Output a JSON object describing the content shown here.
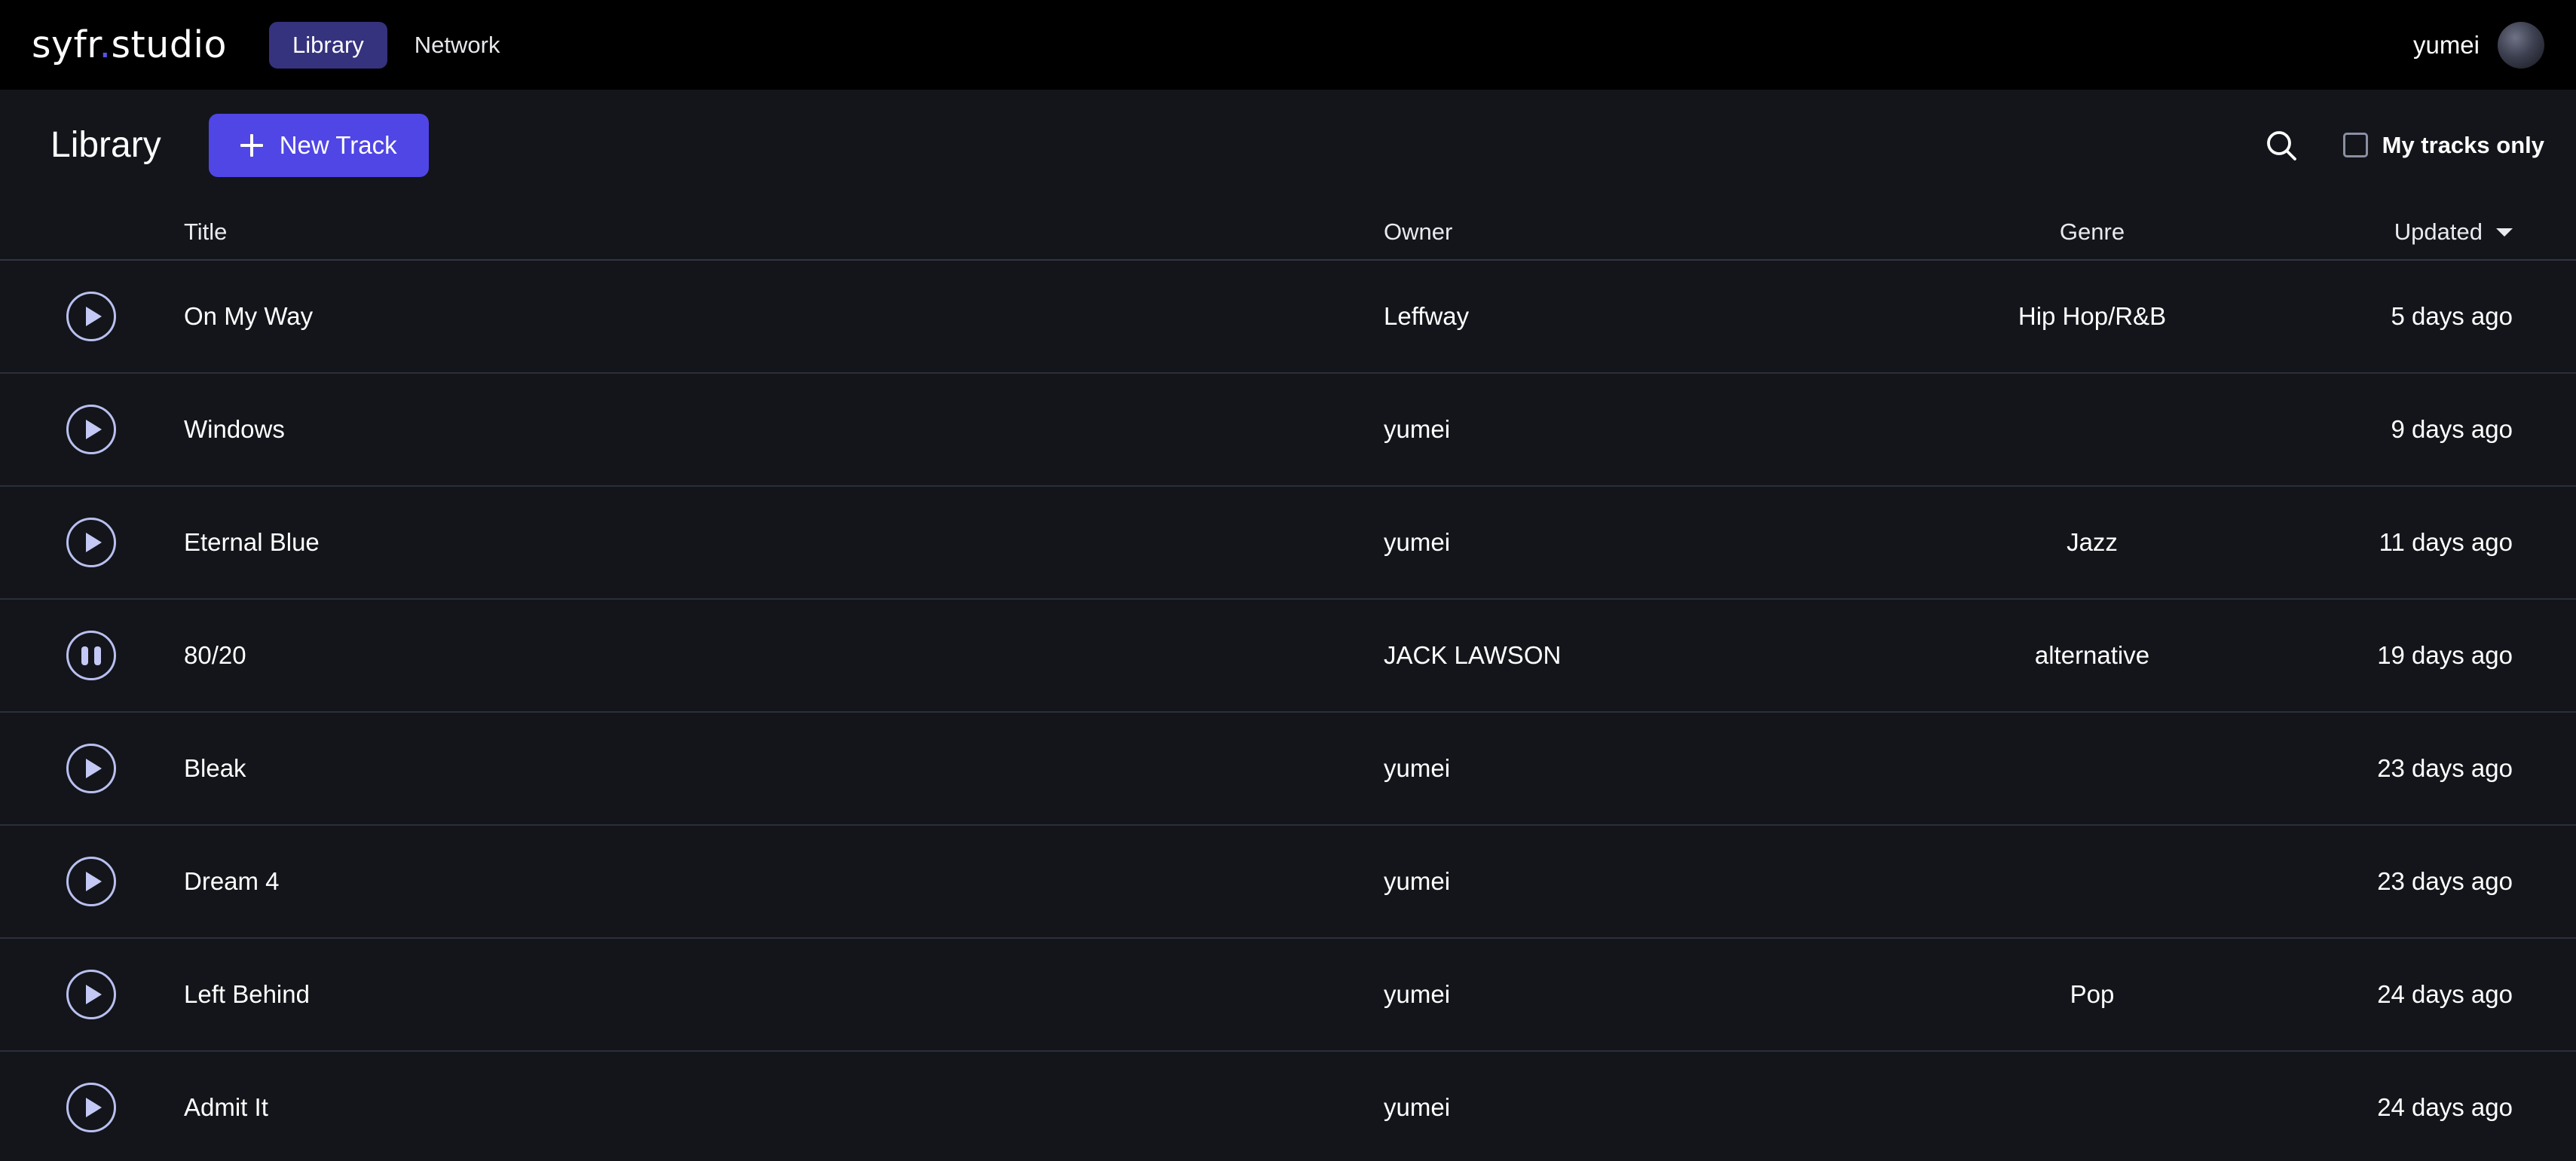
{
  "topbar": {
    "logo_prefix": "syfr",
    "logo_dot": ".",
    "logo_suffix": "studio",
    "nav": [
      {
        "label": "Library",
        "active": true
      },
      {
        "label": "Network",
        "active": false
      }
    ],
    "user_name": "yumei",
    "avatar_icon": "user-avatar"
  },
  "toolbar": {
    "page_title": "Library",
    "new_track_label": "New Track",
    "plus_icon": "plus-icon",
    "search_icon": "search-icon",
    "my_tracks_label": "My tracks only",
    "my_tracks_checked": false
  },
  "table": {
    "columns": {
      "title": "Title",
      "owner": "Owner",
      "genre": "Genre",
      "updated": "Updated"
    },
    "sort_caret_icon": "chevron-down-icon",
    "sorted_by": "Updated",
    "rows": [
      {
        "state_icon": "play-icon",
        "title": "On My Way",
        "owner": "Leffway",
        "genre": "Hip Hop/R&B",
        "updated": "5 days ago"
      },
      {
        "state_icon": "play-icon",
        "title": "Windows",
        "owner": "yumei",
        "genre": "",
        "updated": "9 days ago"
      },
      {
        "state_icon": "play-icon",
        "title": "Eternal Blue",
        "owner": "yumei",
        "genre": "Jazz",
        "updated": "11 days ago"
      },
      {
        "state_icon": "pause-icon",
        "title": "80/20",
        "owner": "JACK LAWSON",
        "genre": "alternative",
        "updated": "19 days ago"
      },
      {
        "state_icon": "play-icon",
        "title": "Bleak",
        "owner": "yumei",
        "genre": "",
        "updated": "23 days ago"
      },
      {
        "state_icon": "play-icon",
        "title": "Dream 4",
        "owner": "yumei",
        "genre": "",
        "updated": "23 days ago"
      },
      {
        "state_icon": "play-icon",
        "title": "Left Behind",
        "owner": "yumei",
        "genre": "Pop",
        "updated": "24 days ago"
      },
      {
        "state_icon": "play-icon",
        "title": "Admit It",
        "owner": "yumei",
        "genre": "",
        "updated": "24 days ago"
      }
    ]
  },
  "colors": {
    "topbar_bg": "#000000",
    "page_bg": "#13151a",
    "nav_pill_bg": "#35327e",
    "accent_button": "#5046e5",
    "logo_dot": "#5b52e8",
    "play_icon": "#c3c9f4",
    "row_divider": "#2a2f3b"
  }
}
